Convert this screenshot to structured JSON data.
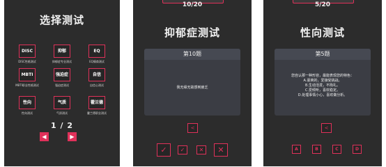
{
  "screen1": {
    "title": "选择测试",
    "tests": [
      {
        "tile": "DISC",
        "label": "DISC性格测试"
      },
      {
        "tile": "抑郁",
        "label": "抑郁症专业测试"
      },
      {
        "tile": "EQ",
        "label": "EQ情商测试"
      },
      {
        "tile": "MBTI",
        "label": "MBTI职业性格测试"
      },
      {
        "tile": "强迫症",
        "label": "强迫症测试"
      },
      {
        "tile": "自信",
        "label": "自信心测试"
      },
      {
        "tile": "性向",
        "label": "性向测试"
      },
      {
        "tile": "气质",
        "label": "气质测试"
      },
      {
        "tile": "霍兰德",
        "label": "霍兰德职业测试"
      }
    ],
    "page_indicator": "1 / 2",
    "prev_icon": "◀",
    "next_icon": "▶"
  },
  "screen2": {
    "progress": "10/20",
    "title": "抑郁症测试",
    "question_header": "第10题",
    "question_text": "我无缘无故感到疲乏",
    "back_icon": "<",
    "answers": [
      "✓",
      "✓",
      "✕",
      "✕"
    ]
  },
  "screen3": {
    "progress": "5/20",
    "title": "性向测试",
    "question_header": "第5题",
    "question_lines": [
      "您自认那一种形容，最能表现您的特色：",
      "A.豪爽的，爱接受挑战。",
      "B.生动活泼，不拘礼。",
      "C.爱倾听，喜欢稳定。",
      "D.处理事情小心，喜欢做分析。"
    ],
    "back_icon": "<",
    "answers": [
      "A",
      "B",
      "C",
      "D"
    ]
  },
  "colors": {
    "background": "#2c2c2c",
    "accent": "#e0315a",
    "card": "#3b3d44"
  }
}
